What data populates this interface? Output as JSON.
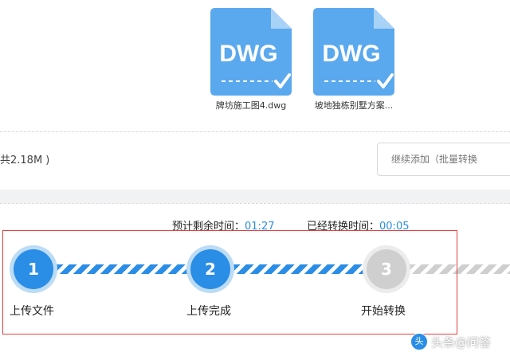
{
  "files": [
    {
      "badge": "DWG",
      "name": "牌坊施工图4.dwg"
    },
    {
      "badge": "DWG",
      "name": "坡地独栋别墅方案..."
    }
  ],
  "upload": {
    "size_text": "共2.18M )",
    "continue_button": "继续添加（批量转换"
  },
  "timing": {
    "remaining_label": "预计剩余时间：",
    "remaining_value": "01:27",
    "elapsed_label": "已经转换时间：",
    "elapsed_value": "00:05"
  },
  "steps": [
    {
      "number": "1",
      "label": "上传文件",
      "state": "done"
    },
    {
      "number": "2",
      "label": "上传完成",
      "state": "done"
    },
    {
      "number": "3",
      "label": "开始转换",
      "state": "pending"
    }
  ],
  "watermark": {
    "text": "头条@问答"
  },
  "colors": {
    "accent": "#2a8de6",
    "pending": "#cfcfcf",
    "frame": "#e24040"
  },
  "icons": {
    "file": "dwg-file-icon",
    "check": "checkmark-icon"
  }
}
